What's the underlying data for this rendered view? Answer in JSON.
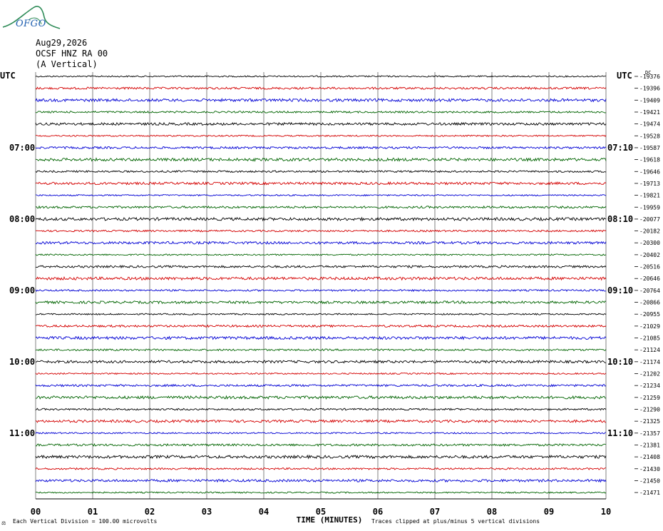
{
  "logo": {
    "text": "OFGO"
  },
  "header": {
    "date": "Aug29,2026",
    "station": "OCSF HNZ RA 00",
    "component": "(A Vertical)"
  },
  "axis": {
    "left_title": "UTC",
    "right_title": "UTC",
    "right_dc_label": "DC",
    "xlabel": "TIME (MINUTES)",
    "xticks": [
      "00",
      "01",
      "02",
      "03",
      "04",
      "05",
      "06",
      "07",
      "08",
      "09",
      "10"
    ],
    "footer_left": "Each Vertical Division =  100.00 microvolts",
    "footer_right": "Traces clipped at plus/minus 5 vertical divisions",
    "corner_mark": "⚖"
  },
  "colors": {
    "trace_cycle": [
      "#000000",
      "#d40000",
      "#0000d4",
      "#006400"
    ],
    "grid": "#808080",
    "logo": "#1f5fb0",
    "logo_swoosh": "#2e8b57"
  },
  "chart_data": {
    "type": "line",
    "title": "",
    "xlabel": "TIME (MINUTES)",
    "xlim": [
      0,
      10
    ],
    "trace_count": 36,
    "minutes_per_trace": 10,
    "left_time_labels": [
      {
        "row": 6,
        "text": "07:00"
      },
      {
        "row": 12,
        "text": "08:00"
      },
      {
        "row": 18,
        "text": "09:00"
      },
      {
        "row": 24,
        "text": "10:00"
      },
      {
        "row": 30,
        "text": "11:00"
      }
    ],
    "right_time_labels": [
      {
        "row": 6,
        "text": "07:10"
      },
      {
        "row": 12,
        "text": "08:10"
      },
      {
        "row": 18,
        "text": "09:10"
      },
      {
        "row": 24,
        "text": "10:10"
      },
      {
        "row": 30,
        "text": "11:10"
      }
    ],
    "dc_offsets": [
      "-19376",
      "-19396",
      "-19409",
      "-19421",
      "-19474",
      "-19528",
      "-19587",
      "-19618",
      "-19646",
      "-19713",
      "-19821",
      "-19959",
      "-20077",
      "-20182",
      "-20300",
      "-20402",
      "-20516",
      "-20646",
      "-20764",
      "-20866",
      "-20955",
      "-21029",
      "-21085",
      "-21124",
      "-21174",
      "-21202",
      "-21234",
      "-21259",
      "-21290",
      "-21325",
      "-21357",
      "-21381",
      "-21408",
      "-21430",
      "-21450",
      "-21471"
    ],
    "grid": true
  }
}
